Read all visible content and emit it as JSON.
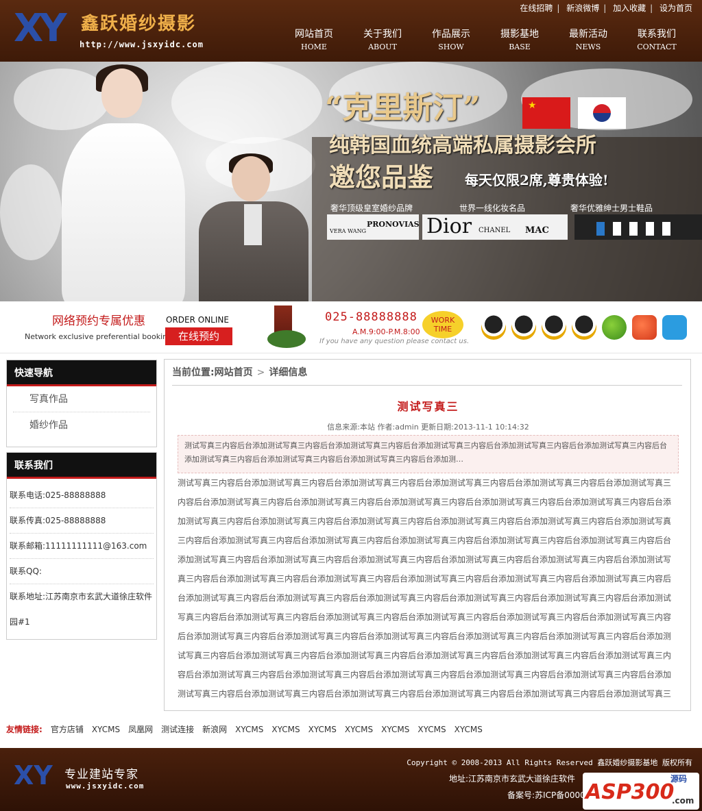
{
  "header": {
    "logo_mark": "XY",
    "site_name": "鑫跃婚纱摄影",
    "site_url": "http://www.jsxyidc.com",
    "top_links": [
      "在线招聘",
      "新浪微博",
      "加入收藏",
      "设为首页"
    ],
    "nav": [
      {
        "cn": "网站首页",
        "en": "HOME"
      },
      {
        "cn": "关于我们",
        "en": "ABOUT"
      },
      {
        "cn": "作品展示",
        "en": "SHOW"
      },
      {
        "cn": "摄影基地",
        "en": "BASE"
      },
      {
        "cn": "最新活动",
        "en": "NEWS"
      },
      {
        "cn": "联系我们",
        "en": "CONTACT"
      }
    ]
  },
  "banner": {
    "headline": "“克里斯汀”",
    "line2": "纯韩国血统高端私属摄影会所",
    "line3": "邀您品鉴",
    "line4": "每天仅限2席,尊贵体验!",
    "captions": [
      "奢华顶级皇室婚纱品牌",
      "世界一线化妆名品",
      "奢华优雅绅士男士鞋品"
    ],
    "brand_1a": "VERA WANG",
    "brand_1b": "PRONOVIAS",
    "brand_2a": "Dior",
    "brand_2b": "CHANEL",
    "brand_2c": "MAC",
    "slides_total": 5,
    "slide_active": 1
  },
  "booking": {
    "title": "网络预约专属优惠",
    "subtitle": "Network exclusive preferential booking",
    "order_online": "ORDER ONLINE",
    "button": "在线预约",
    "phone": "025-88888888",
    "hours": "A.M.9:00-P.M.8:00",
    "question": "If you have any question please contact us.",
    "work_time": "WORK TIME",
    "icons": [
      "qq-icon",
      "qq-icon",
      "qq-icon",
      "qq-icon",
      "msn-icon",
      "weibo-icon",
      "tencent-weibo-icon"
    ]
  },
  "sidebar": {
    "nav_title": "快速导航",
    "nav_items": [
      "写真作品",
      "婚纱作品"
    ],
    "contact_title": "联系我们",
    "contact": {
      "phone": "联系电话:025-88888888",
      "fax": "联系传真:025-88888888",
      "email": "联系邮箱:11111111111@163.com",
      "qq": "联系QQ:",
      "address": "联系地址:江苏南京市玄武大道徐庄软件园#1"
    }
  },
  "main": {
    "crumb_label": "当前位置:",
    "crumb_home": "网站首页",
    "crumb_current": "详细信息",
    "title": "测试写真三",
    "meta": "信息来源:本站 作者:admin 更新日期:2013-11-1 10:14:32",
    "summary": "测试写真三内容后台添加测试写真三内容后台添加测试写真三内容后台添加测试写真三内容后台添加测试写真三内容后台添加测试写真三内容后台添加测试写真三内容后台添加测试写真三内容后台添加测试写真三内容后台添加测…",
    "body": "测试写真三内容后台添加测试写真三内容后台添加测试写真三内容后台添加测试写真三内容后台添加测试写真三内容后台添加测试写真三内容后台添加测试写真三内容后台添加测试写真三内容后台添加测试写真三内容后台添加测试写真三内容后台添加测试写真三内容后台添加测试写真三内容后台添加测试写真三内容后台添加测试写真三内容后台添加测试写真三内容后台添加测试写真三内容后台添加测试写真三内容后台添加测试写真三内容后台添加测试写真三内容后台添加测试写真三内容后台添加测试写真三内容后台添加测试写真三内容后台添加测试写真三内容后台添加测试写真三内容后台添加测试写真三内容后台添加测试写真三内容后台添加测试写真三内容后台添加测试写真三内容后台添加测试写真三内容后台添加测试写真三内容后台添加测试写真三内容后台添加测试写真三内容后台添加测试写真三内容后台添加测试写真三内容后台添加测试写真三内容后台添加测试写真三内容后台添加测试写真三内容后台添加测试写真三内容后台添加测试写真三内容后台添加测试写真三内容后台添加测试写真三内容后台添加测试写真三内容后台添加测试写真三内容后台添加测试写真三内容后台添加测试写真三内容后台添加测试写真三内容后台添加测试写真三内容后台添加测试写真三内容后台添加测试写真三内容后台添加测试写真三内容后台添加测试写真三内容后台添加测试写真三内容后台添加测试写真三内容后台添加测试写真三内容后台添加测试写真三内容后台添加测试写真三内容后台添加测试写真三内容后台添加测试写真三内容后台添加测试写真三内容后台添加测试写真三内容后台添加测试写真三内容后台添加测试写真三内容后台添加测试写真三内容后台添加测试写真三内容后台添加测试写真三内容后台添加测试写真三内容后台添加测试写真三内容后台添加测试写真三内容后台添加测试写真三内容后台添加测试写真三内容后台添加测试写真三内容后台添加测试写真三内容后台添加测试写真三内容后台添加测试写真三内容后台添加"
  },
  "links": {
    "label": "友情链接:",
    "items": [
      "官方店铺",
      "XYCMS",
      "凤凰网",
      "测试连接",
      "新浪网",
      "XYCMS",
      "XYCMS",
      "XYCMS",
      "XYCMS",
      "XYCMS",
      "XYCMS",
      "XYCMS"
    ]
  },
  "footer": {
    "logo_mark": "XY",
    "slogan": "专业建站专家",
    "url": "www.jsxyidc.com",
    "copyright": "Copyright © 2008-2013 All Rights Reserved 鑫跃婚纱摄影基地 版权所有",
    "address": "地址:江苏南京市玄武大道徐庄软件",
    "icp": "备案号:苏ICP备0000",
    "watermark": "ASP300",
    "watermark_a": "源码",
    "watermark_b": ".com"
  },
  "colors": {
    "header_brown": "#4a200c",
    "accent_red": "#c31a1a",
    "logo_gold": "#f0b04a",
    "logo_blue": "#2b4fa8"
  }
}
